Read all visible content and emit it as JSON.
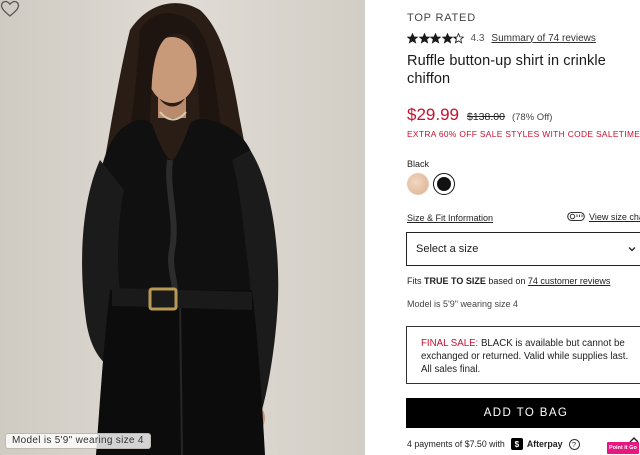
{
  "photo": {
    "model_caption": "Model is 5'9\" wearing size 4",
    "icons": {
      "favorite": "heart-icon"
    }
  },
  "product": {
    "badge": "TOP RATED",
    "rating": {
      "value": "4.3",
      "stars_filled": 4.3,
      "stars_total": 5,
      "summary_link": "Summary of 74 reviews"
    },
    "title": "Ruffle button-up shirt in crinkle chiffon",
    "price": {
      "sale": "$29.99",
      "original": "$138.00",
      "discount": "(78% Off)"
    },
    "promo": "EXTRA 60% OFF SALE STYLES WITH CODE SALETIME",
    "color": {
      "label": "Black",
      "swatches": [
        "Nude",
        "Black"
      ],
      "selected": "Black"
    },
    "size_fit_link": "Size & Fit Information",
    "size_chart_link": "View size cha",
    "size_select": {
      "placeholder": "Select a size"
    },
    "fit": {
      "prefix": "Fits ",
      "value": "TRUE TO SIZE",
      "middle": " based on ",
      "link": "74 customer reviews"
    },
    "model_info": "Model is 5'9\" wearing size 4",
    "final_sale": {
      "label": "FINAL SALE:",
      "text": " BLACK is available but cannot be exchanged or returned. Valid while supplies last. All sales final."
    },
    "add_to_bag": "ADD TO BAG",
    "afterpay": {
      "text": "4 payments of $7.50 with",
      "brand": "Afterpay",
      "info": "?"
    },
    "tag_badge": "Point it Go"
  },
  "colors": {
    "sale_red": "#c8102e",
    "button_bg": "#000000",
    "text": "#1a1a1a"
  }
}
